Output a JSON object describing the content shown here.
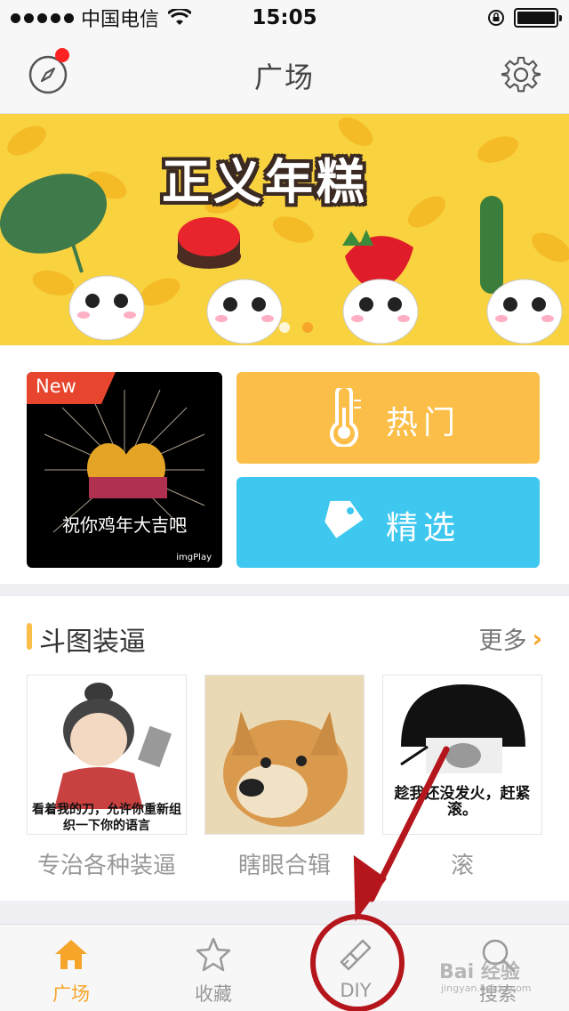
{
  "status_bar": {
    "carrier": "中国电信",
    "time": "15:05"
  },
  "nav": {
    "title": "广场"
  },
  "banner": {
    "title": "正义年糕",
    "page_count": 3,
    "active_page": 3
  },
  "feature": {
    "new_badge": "New",
    "new_caption": "祝你鸡年大吉吧",
    "watermark": "imgPlay",
    "hot_label": "热门",
    "pick_label": "精选"
  },
  "section": {
    "title": "斗图装逼",
    "more_label": "更多",
    "items": [
      {
        "caption": "专治各种装逼",
        "image_text": "看着我的刀，允许你重新组织一下你的语言"
      },
      {
        "caption": "瞎眼合辑",
        "image_text": ""
      },
      {
        "caption": "滚",
        "image_text": "趁我还没发火，赶紧滚。"
      }
    ]
  },
  "tabs": [
    {
      "label": "广场",
      "icon": "home-icon",
      "active": true
    },
    {
      "label": "收藏",
      "icon": "star-icon",
      "active": false
    },
    {
      "label": "DIY",
      "icon": "brush-icon",
      "active": false
    },
    {
      "label": "搜索",
      "icon": "search-icon",
      "active": false
    }
  ],
  "watermark": {
    "brand": "Bai 经验",
    "url": "jingyan.baidu.com"
  },
  "colors": {
    "accent": "#f6a52a",
    "hot": "#fbbf49",
    "pick": "#3ec7ef",
    "annotation": "#b5161c"
  }
}
